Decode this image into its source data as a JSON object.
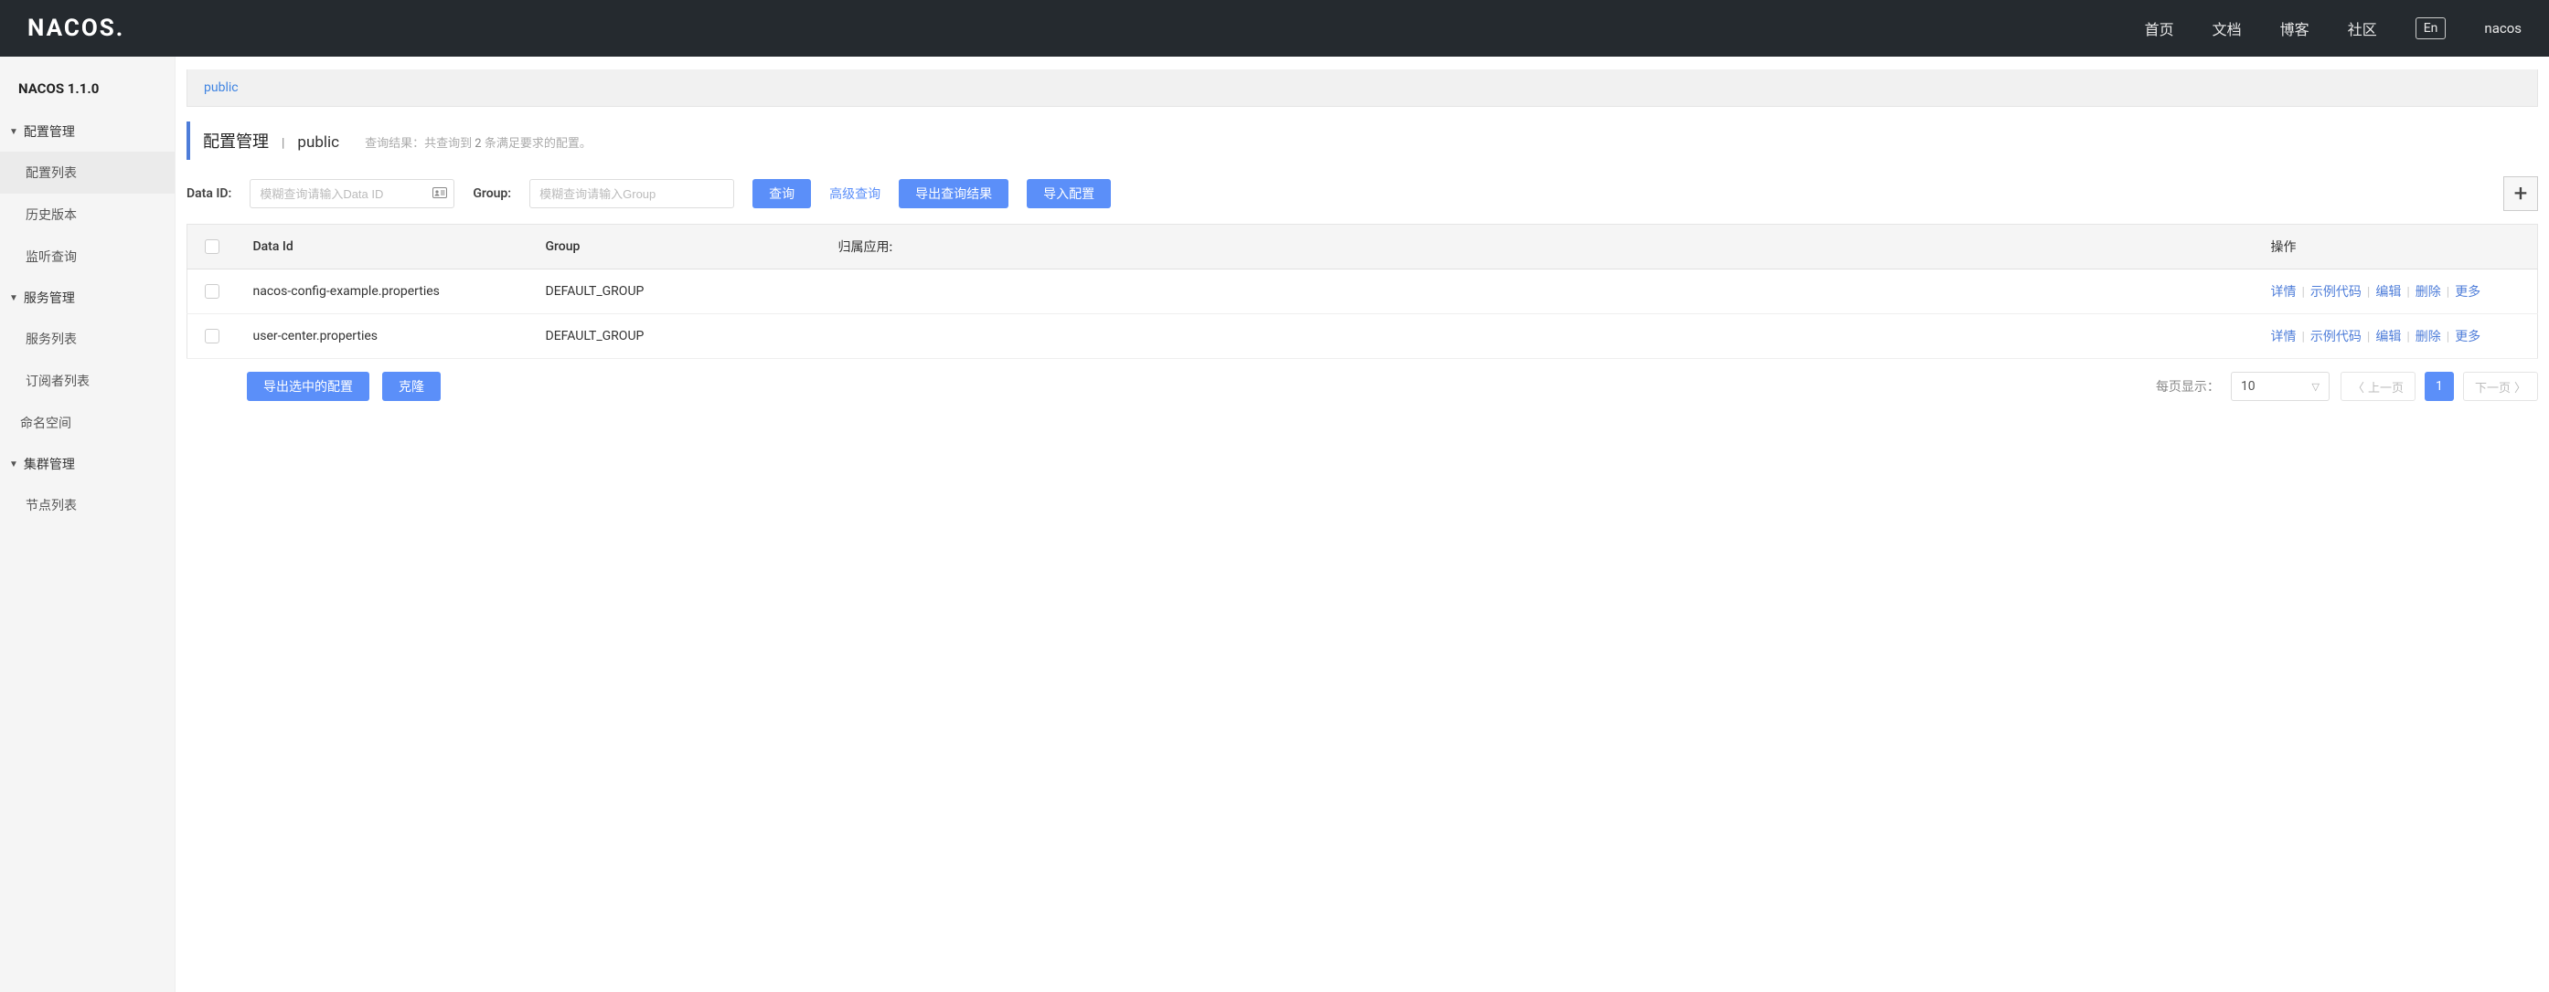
{
  "header": {
    "logo": "NACOS.",
    "nav": [
      "首页",
      "文档",
      "博客",
      "社区"
    ],
    "lang": "En",
    "user": "nacos"
  },
  "sidebar": {
    "title": "NACOS 1.1.0",
    "groups": [
      {
        "label": "配置管理",
        "items": [
          "配置列表",
          "历史版本",
          "监听查询"
        ],
        "active_index": 0
      },
      {
        "label": "服务管理",
        "items": [
          "服务列表",
          "订阅者列表"
        ]
      }
    ],
    "standalone": "命名空间",
    "group3": {
      "label": "集群管理",
      "items": [
        "节点列表"
      ]
    }
  },
  "namespace_link": "public",
  "page_title": {
    "title": "配置管理",
    "ns": "public",
    "result_prefix": "查询结果：共查询到 ",
    "result_count": "2",
    "result_suffix": " 条满足要求的配置。"
  },
  "search": {
    "dataid_label": "Data ID:",
    "dataid_placeholder": "模糊查询请输入Data ID",
    "group_label": "Group:",
    "group_placeholder": "模糊查询请输入Group",
    "query_btn": "查询",
    "adv_btn": "高级查询",
    "export_btn": "导出查询结果",
    "import_btn": "导入配置"
  },
  "table": {
    "headers": {
      "dataid": "Data Id",
      "group": "Group",
      "app": "归属应用:",
      "ops": "操作"
    },
    "rows": [
      {
        "dataid": "nacos-config-example.properties",
        "group": "DEFAULT_GROUP",
        "app": ""
      },
      {
        "dataid": "user-center.properties",
        "group": "DEFAULT_GROUP",
        "app": ""
      }
    ],
    "ops": {
      "detail": "详情",
      "sample": "示例代码",
      "edit": "编辑",
      "delete": "删除",
      "more": "更多"
    }
  },
  "footer": {
    "export_selected": "导出选中的配置",
    "clone": "克隆",
    "pagesize_label": "每页显示：",
    "pagesize_value": "10",
    "prev": "上一页",
    "page": "1",
    "next": "下一页"
  }
}
